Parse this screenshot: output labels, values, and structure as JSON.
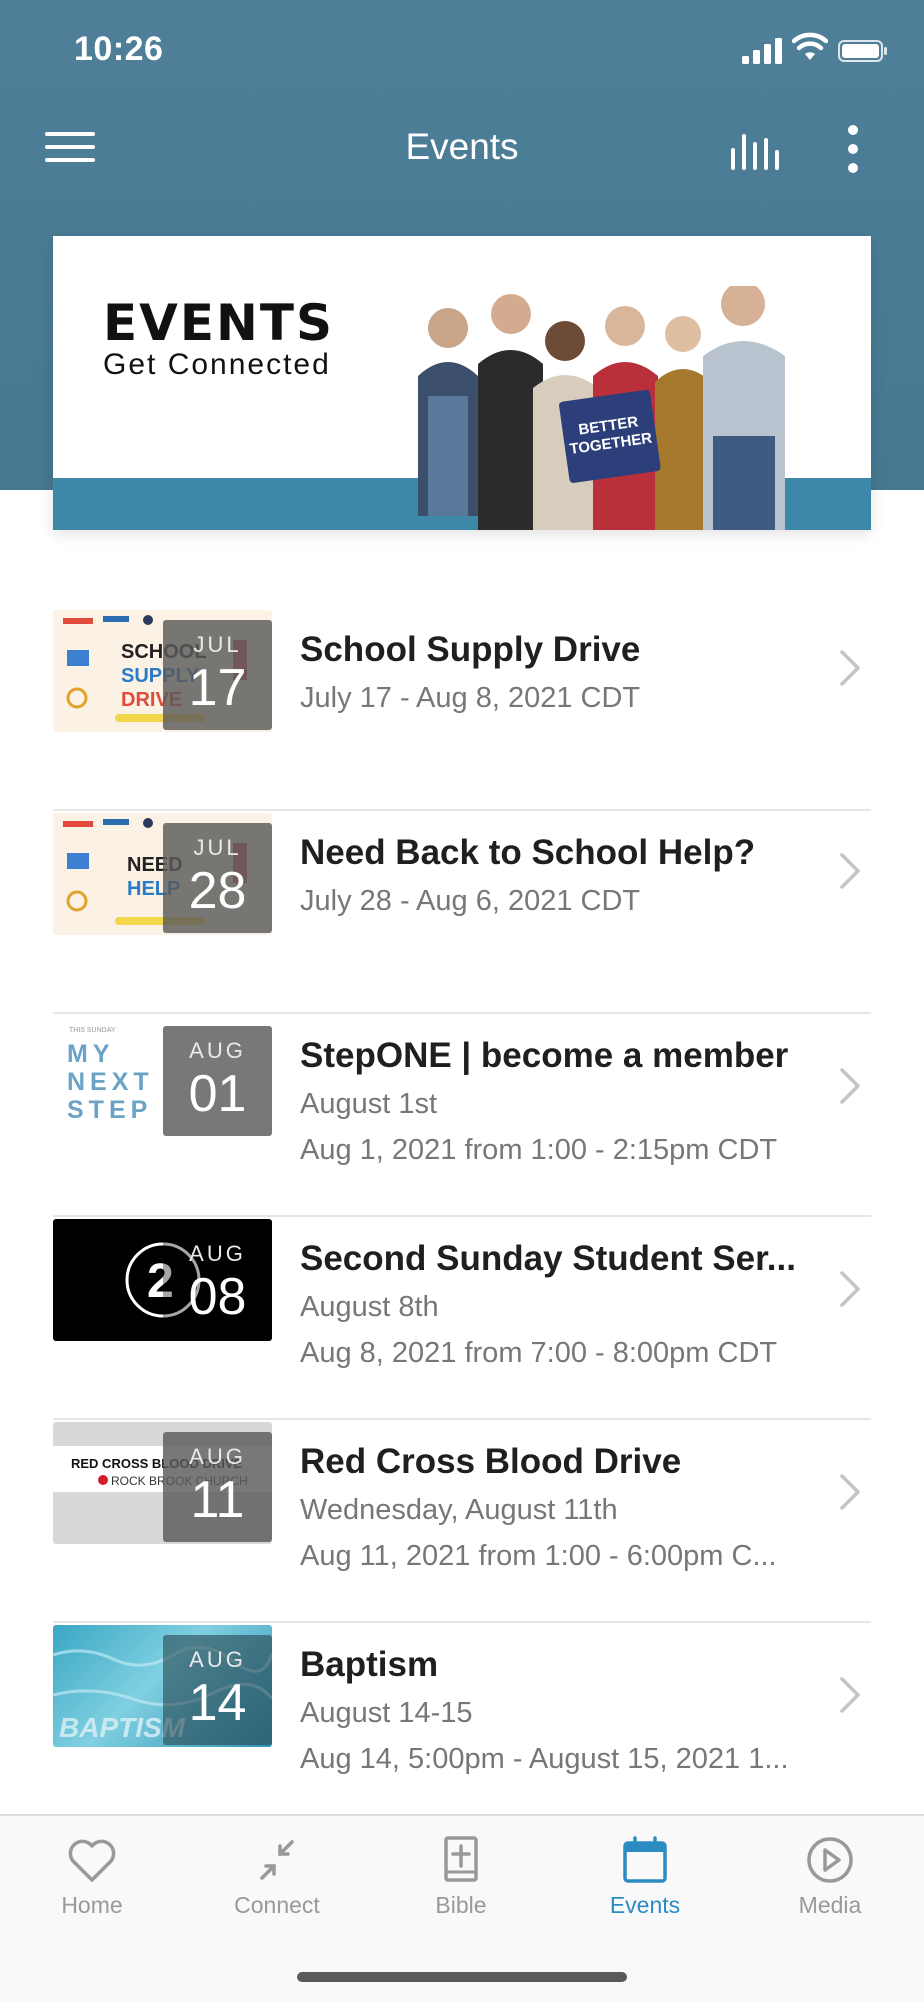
{
  "status_bar": {
    "time": "10:26"
  },
  "nav": {
    "title": "Events"
  },
  "banner": {
    "title": "EVENTS",
    "subtitle": "Get Connected",
    "sign_text_1": "BETTER",
    "sign_text_2": "TOGETHER"
  },
  "events": [
    {
      "title": "School Supply Drive",
      "line2": "July 17 - Aug 8, 2021 CDT",
      "line3": "",
      "month": "JUL",
      "day": "17",
      "thumb_line1": "SCHOOL",
      "thumb_line2": "SUPPLY",
      "thumb_line3": "DRIVE"
    },
    {
      "title": "Need Back to School Help?",
      "line2": "July 28 - Aug 6, 2021 CDT",
      "line3": "",
      "month": "JUL",
      "day": "28",
      "thumb_line1": "NEED",
      "thumb_line2": "HELP"
    },
    {
      "title": "StepONE | become a member",
      "line2": "August 1st",
      "line3": "Aug 1, 2021 from 1:00 - 2:15pm CDT",
      "month": "AUG",
      "day": "01",
      "thumb_small": "THIS SUNDAY",
      "thumb_line1": "MY",
      "thumb_line2": "NEXT",
      "thumb_line3": "STEP"
    },
    {
      "title": "Second Sunday Student Ser...",
      "line2": "August 8th",
      "line3": "Aug 8, 2021 from 7:00 - 8:00pm CDT",
      "month": "AUG",
      "day": "08",
      "thumb_line1": "2"
    },
    {
      "title": "Red Cross Blood Drive",
      "line2": "Wednesday, August 11th",
      "line3": "Aug 11, 2021 from 1:00 - 6:00pm C...",
      "month": "AUG",
      "day": "11",
      "thumb_line1": "RED CROSS BLOOD DRIVE",
      "thumb_line2": "ROCK BROOK CHURCH"
    },
    {
      "title": "Baptism",
      "line2": "August 14-15",
      "line3": "Aug 14, 5:00pm - August 15, 2021 1...",
      "month": "AUG",
      "day": "14",
      "thumb_line1": "BAPTISM"
    }
  ],
  "tabs": [
    {
      "label": "Home",
      "icon": "heart-icon"
    },
    {
      "label": "Connect",
      "icon": "connect-arrows-icon"
    },
    {
      "label": "Bible",
      "icon": "bible-icon"
    },
    {
      "label": "Events",
      "icon": "calendar-icon"
    },
    {
      "label": "Media",
      "icon": "play-circle-icon"
    }
  ],
  "colors": {
    "header": "#4f7f99",
    "accent": "#2a8cc0",
    "banner_strip": "#3d87a8"
  }
}
